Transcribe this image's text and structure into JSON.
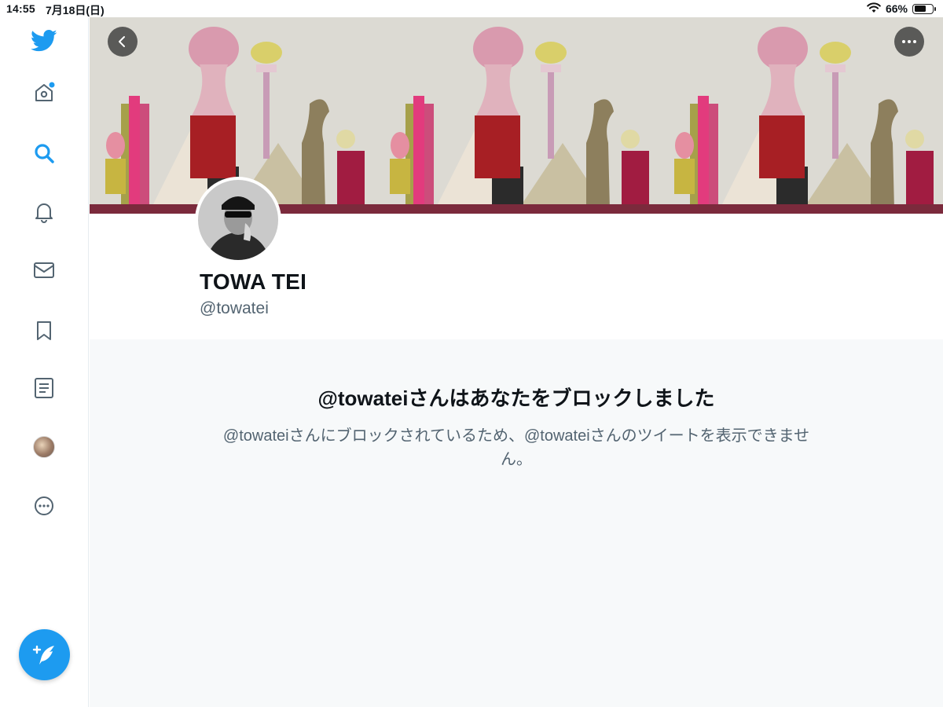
{
  "status_bar": {
    "time": "14:55",
    "date": "7月18日(日)",
    "battery": "66%",
    "battery_level": 0.66
  },
  "sidebar": {
    "items": [
      {
        "icon": "twitter-bird-icon",
        "color": "#1d9bf0"
      },
      {
        "icon": "home-icon",
        "has_notification_dot": true
      },
      {
        "icon": "search-icon",
        "active": true,
        "color": "#1d9bf0"
      },
      {
        "icon": "bell-icon"
      },
      {
        "icon": "mail-icon"
      },
      {
        "icon": "bookmark-icon"
      },
      {
        "icon": "lists-icon"
      },
      {
        "icon": "avatar"
      },
      {
        "icon": "more-circle-icon"
      }
    ],
    "compose_icon": "compose-quill-icon"
  },
  "profile": {
    "name": "TOWA TEI",
    "handle": "@towatei"
  },
  "blocked": {
    "title": "@towateiさんはあなたをブロックしました",
    "body": "@towateiさんにブロックされているため、@towateiさんのツイートを表示できません。"
  },
  "colors": {
    "accent": "#1d9bf0",
    "secondary_text": "#536471",
    "background": "#f7f9fa"
  }
}
